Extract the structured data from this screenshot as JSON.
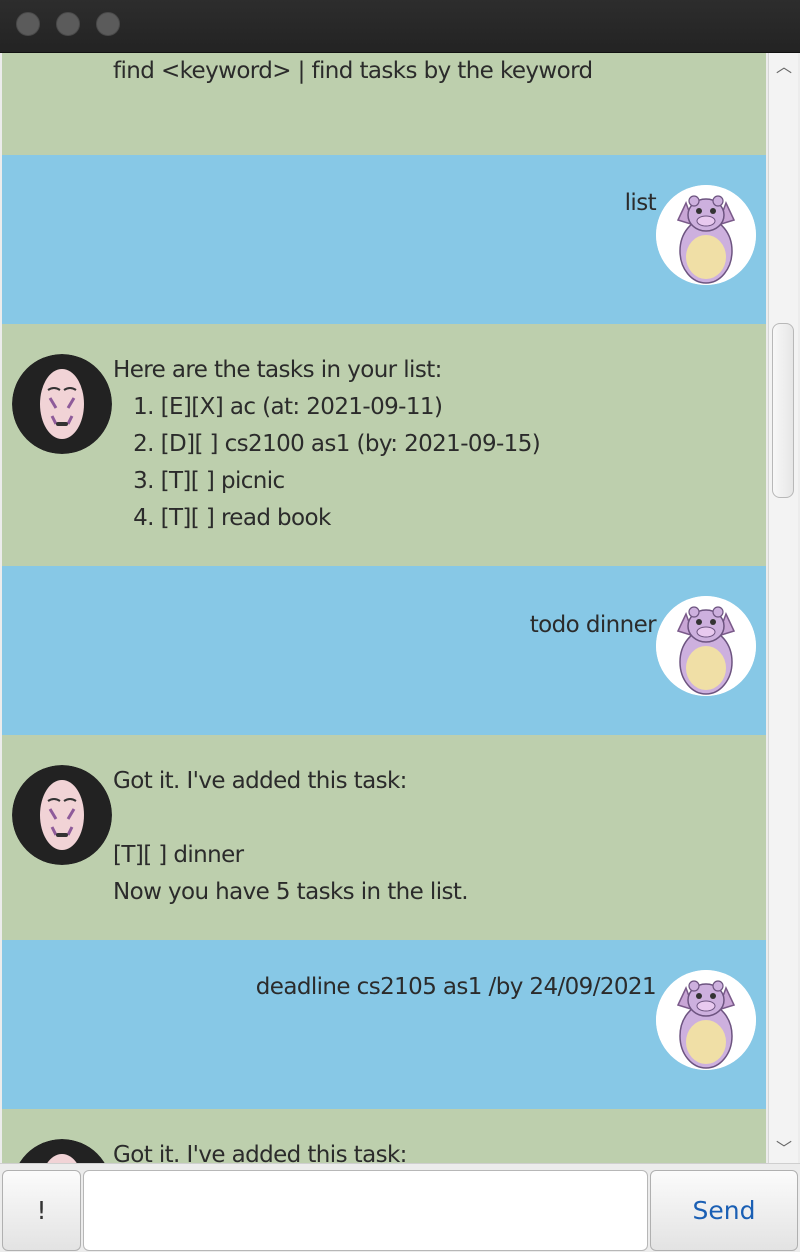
{
  "window": {
    "title": ""
  },
  "messages": [
    {
      "sender": "duke",
      "text": "find <keyword> | find tasks by the keyword"
    },
    {
      "sender": "user",
      "text": "list"
    },
    {
      "sender": "duke",
      "text": "Here are the tasks in your list:\n   1. [E][X] ac (at: 2021-09-11)\n   2. [D][ ] cs2100 as1 (by: 2021-09-15)\n   3. [T][ ] picnic\n   4. [T][ ] read book"
    },
    {
      "sender": "user",
      "text": "todo dinner"
    },
    {
      "sender": "duke",
      "text": "Got it. I've added this task:\n\n[T][ ] dinner\nNow you have 5 tasks in the list."
    },
    {
      "sender": "user",
      "text": "deadline cs2105 as1 /by 24/09/2021"
    },
    {
      "sender": "duke",
      "text": "Got it. I've added this task:"
    }
  ],
  "input": {
    "value": "",
    "placeholder": ""
  },
  "buttons": {
    "left_label": "!",
    "send_label": "Send"
  },
  "colors": {
    "duke_bg": "#bdcfad",
    "user_bg": "#87c8e6",
    "send_text": "#1a5fb4"
  },
  "icons": {
    "duke_avatar": "noface-mask-icon",
    "user_avatar": "hippo-mascot-icon"
  }
}
